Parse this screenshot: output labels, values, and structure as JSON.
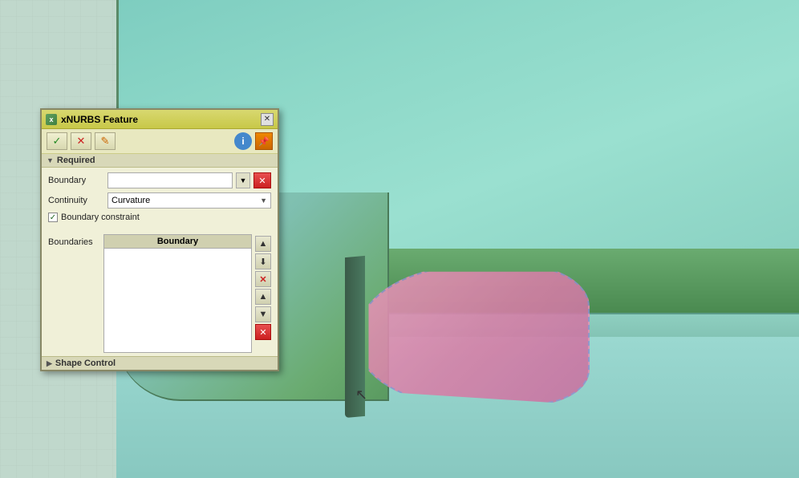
{
  "viewport": {
    "background_color": "#b8d4c8"
  },
  "dialog": {
    "title": "xNURBS Feature",
    "icon_label": "x",
    "close_label": "✕",
    "toolbar": {
      "confirm_label": "✓",
      "cancel_label": "✕",
      "edit_label": "✎",
      "info_label": "i",
      "pin_label": "📌"
    },
    "sections": {
      "required": {
        "label": "Required",
        "triangle": "▼"
      },
      "shape_control": {
        "label": "Shape Control",
        "triangle": "▶"
      }
    },
    "form": {
      "boundary_label": "Boundary",
      "boundary_dropdown_label": "▼",
      "boundary_action_label": "✕",
      "continuity_label": "Continuity",
      "continuity_value": "Curvature",
      "continuity_arrow": "▼",
      "boundary_constraint_label": "Boundary constraint",
      "boundaries_label": "Boundaries",
      "boundary_col_header": "Boundary"
    },
    "boundary_controls": {
      "up_label": "▲",
      "download_label": "⬇",
      "delete_label": "✕",
      "move_up_label": "▲",
      "move_down_label": "▼",
      "action_label": "✕"
    }
  }
}
